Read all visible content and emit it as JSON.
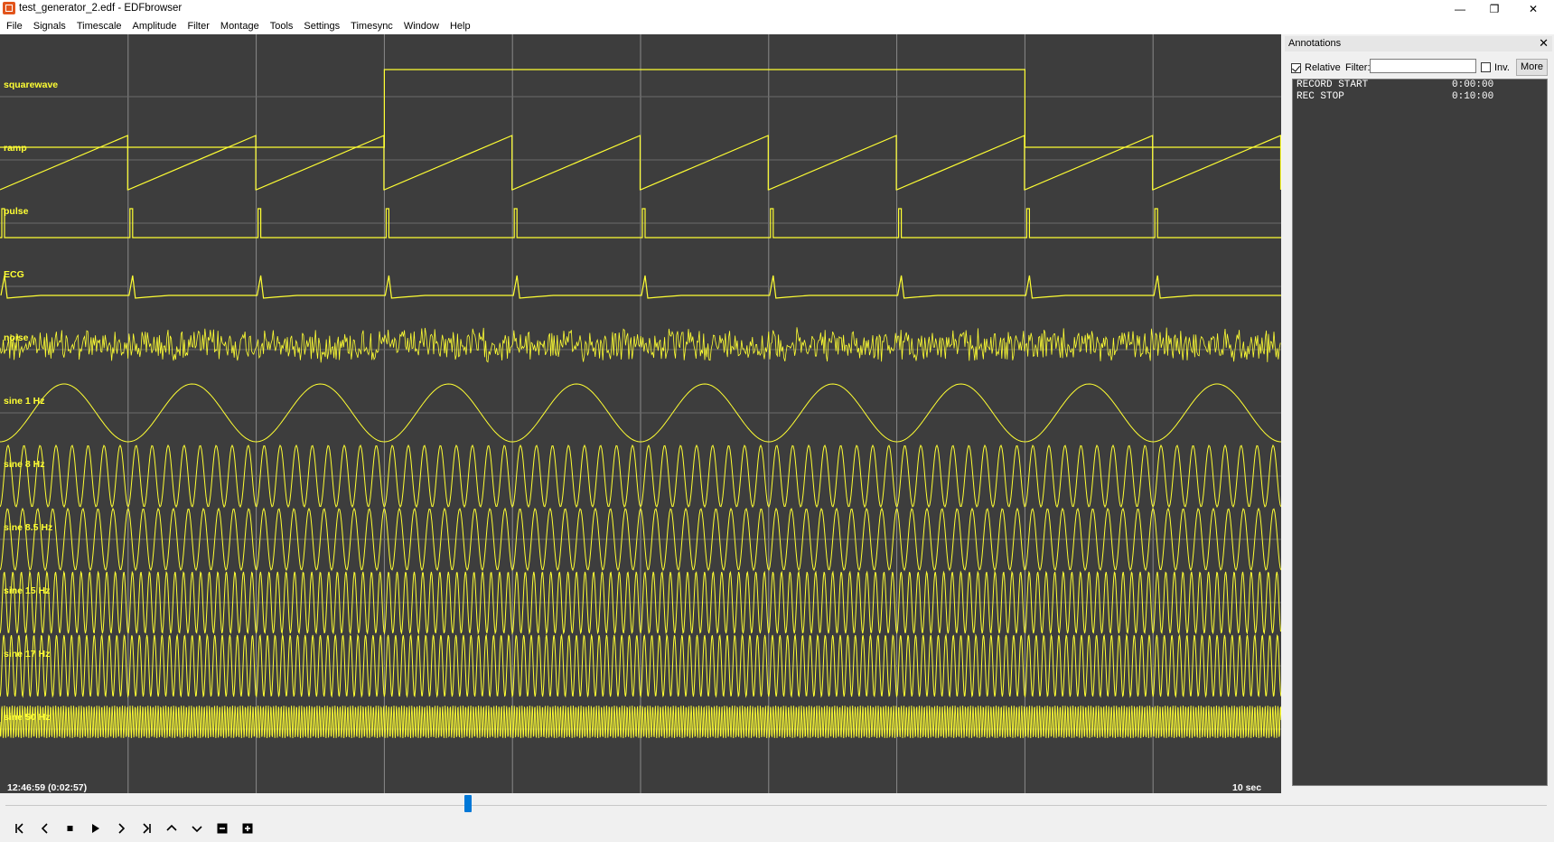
{
  "window": {
    "title": "test_generator_2.edf - EDFbrowser",
    "minimize_glyph": "—",
    "maximize_glyph": "❐",
    "close_glyph": "✕"
  },
  "menu": [
    "File",
    "Signals",
    "Timescale",
    "Amplitude",
    "Filter",
    "Montage",
    "Tools",
    "Settings",
    "Timesync",
    "Window",
    "Help"
  ],
  "colors": {
    "trace": "#ffff33",
    "background": "#3d3d3d",
    "grid": "#8a8a8a",
    "accent": "#0078d7"
  },
  "signals": [
    {
      "label": "squarewave"
    },
    {
      "label": "ramp"
    },
    {
      "label": "pulse"
    },
    {
      "label": "ECG"
    },
    {
      "label": "noise"
    },
    {
      "label": "sine 1 Hz"
    },
    {
      "label": "sine 8 Hz"
    },
    {
      "label": "sine 8.5 Hz"
    },
    {
      "label": "sine 15 Hz"
    },
    {
      "label": "sine 17 Hz"
    },
    {
      "label": "sine 50 Hz"
    }
  ],
  "status": {
    "time": "12:46:59 (0:02:57)",
    "timescale": "10 sec"
  },
  "annotations_panel": {
    "title": "Annotations",
    "close_glyph": "✕",
    "relative_label": "Relative",
    "relative_checked": true,
    "filter_label": "Filter:",
    "filter_value": "",
    "inv_label": "Inv.",
    "inv_checked": false,
    "more_label": "More",
    "items": [
      {
        "description": "RECORD START",
        "time": "0:00:00"
      },
      {
        "description": "REC STOP",
        "time": "0:10:00"
      }
    ]
  },
  "scrollbar": {
    "position_fraction": 0.3
  },
  "toolbar": {
    "buttons": [
      {
        "name": "first-page-button",
        "icon": "skip-to-start-icon"
      },
      {
        "name": "previous-page-button",
        "icon": "chevron-left-icon"
      },
      {
        "name": "stop-button",
        "icon": "stop-icon"
      },
      {
        "name": "play-button",
        "icon": "play-icon"
      },
      {
        "name": "next-page-button",
        "icon": "chevron-right-icon"
      },
      {
        "name": "last-page-button",
        "icon": "skip-to-end-icon"
      },
      {
        "name": "shift-up-button",
        "icon": "chevron-up-icon"
      },
      {
        "name": "shift-down-button",
        "icon": "chevron-down-icon"
      },
      {
        "name": "zoom-out-button",
        "icon": "minus-box-icon"
      },
      {
        "name": "zoom-in-button",
        "icon": "plus-box-icon"
      }
    ]
  }
}
